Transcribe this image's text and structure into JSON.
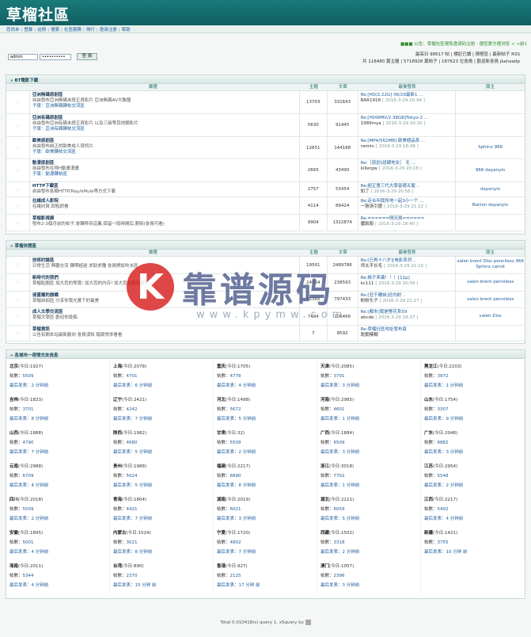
{
  "header": {
    "title": "草榴社區"
  },
  "nav": {
    "items": [
      "您尚未",
      "登錄",
      "註冊",
      "搜索",
      "社區服務",
      "排行",
      "邀请注册",
      "幫助"
    ]
  },
  "notice": "■■■ 公告：草榴社區現免邀请码注册 - 便您更方便浏览 < <前1",
  "stats": {
    "line1": "最高日 98617 帖 | 標記已讀 | 積極區 | 最新帖子 RSS",
    "line2": "共 118480 篇主題 | 5718928 篇帖子 | 187623 位會員 | 歡迎新會員 jkahaadp"
  },
  "login": {
    "user": "admin",
    "pass": "••••••••••",
    "submit": "登 錄"
  },
  "sections": {
    "bt": {
      "title": "» BT電影下載",
      "cols": [
        "論壇",
        "主題",
        "文章",
        "最後發表",
        "版主"
      ],
      "rows": [
        {
          "name": "亞洲無碼原創區",
          "desc": "自由發布亞洲無碼未經正資影片 亞洲無碼AV大聯盟",
          "sub": "子版：亞洲無碼轉帖交流區",
          "topics": "13703",
          "posts": "331643",
          "last": "Re:[HD/2.22G] 06/29最新1 ...",
          "by": "BAR1918",
          "date": "[ 2016-3-29 20:44 ]",
          "mod": ""
        },
        {
          "name": "亞洲有碼原創區",
          "desc": "自由發布亞洲有碼未經正資影片 以及三級等其他類影片",
          "sub": "子版：亞洲有碼轉帖交流區",
          "topics": "5630",
          "posts": "91445",
          "last": "Re:[HDWMV/2.38GB]Tokyo-2 ...",
          "by": "1989mya",
          "date": "[ 2016-3-29 20:20 ]",
          "mod": ""
        },
        {
          "name": "歐美原創區",
          "desc": "自由發布純正的歐美成人資訊片",
          "sub": "子版：歐美轉帖交流區",
          "topics": "12651",
          "posts": "144188",
          "last": "Re:[MP4/562MB] 歐美極品系 ...",
          "by": "nemin",
          "date": "[ 2016-3-29 18:48 ]",
          "mod": "Sphinx 966"
        },
        {
          "name": "動漫原創區",
          "desc": "自由發布在得H動畫漫畫",
          "sub": "子版：動漫轉帖區",
          "topics": "2665",
          "posts": "43490",
          "last": "Re:［原創]班肆地女］ 无 ...",
          "by": "killergw",
          "date": "[ 2016-3-29 20:18 ]",
          "mod": "966 dayanyin"
        },
        {
          "name": "HTTP下載區",
          "desc": "自由發布各類HTTP/Ray/eMule等方式下載",
          "sub": "",
          "topics": "2757",
          "posts": "53454",
          "last": "Re:超正童三代大學皆德五屋 ..",
          "by": "知了",
          "date": "[ 2016-3-29 20:56 ]",
          "mod": "dayanyin"
        },
        {
          "name": "在綫成人影院",
          "desc": "在綫欣賞,即點即看",
          "sub": "",
          "topics": "4114",
          "posts": "89424",
          "last": "Re:走合叫我所地一起3小一个 ...",
          "by": "一張清引證",
          "date": "[ 2016-3-29 21:22 ]",
          "mod": "Barton dayanyin"
        },
        {
          "name": "草榴影視庫",
          "desc": "發布2-3個月前的帖子,會轉移到這裏,保留一段時間后,刪除(會員可看)",
          "sub": "",
          "topics": "9904",
          "posts": "1322874",
          "last": "Re:======剛天兩======",
          "by": "魔凱殺",
          "date": "[ 2016-3-29 18:40 ]",
          "mod": ""
        }
      ]
    },
    "talk": {
      "title": "» 草榴休閒區",
      "cols": [
        "論壇",
        "主題",
        "文章",
        "最後發表",
        "版主"
      ],
      "rows": [
        {
          "name": "技術討論區",
          "desc": "日常生活 興趣交流 轉帶超過 求助求種 會員閑談吹水區",
          "sub": "",
          "topics": "19561",
          "posts": "2489786",
          "last": "Re:[已再十八岁][电影系列 ..",
          "by": "师太不长毛",
          "date": "[ 2016-3-29 21:10 ]",
          "mod": "valen brent Diss penniless 966 Sphinx carrot"
        },
        {
          "name": "新時代的我們",
          "desc": "草榴貼圖區 加大您的零寬! 加大您的内存! 加大您的腦容量!",
          "sub": "",
          "topics": "24564",
          "posts": "238593",
          "last": "Re:姊子来袭！！！[11p]",
          "by": "kc111",
          "date": "[ 2016-3-29 20:39 ]",
          "mod": "valen brent penniless"
        },
        {
          "name": "達蓋爾的旗幟",
          "desc": "草榴自拍區 分享你我光覺下的最美",
          "sub": "",
          "topics": "15365",
          "posts": "797433",
          "last": "Re:[狂干嫩妹]还内射 ..",
          "by": "粉粉头子",
          "date": "[ 2016-3-29 21:27 ]",
          "mod": "valen brent penniless"
        },
        {
          "name": "成人文學交流區",
          "desc": "草榴文學區 歡迎你投稿",
          "sub": "",
          "topics": "7494",
          "posts": "106466",
          "last": "Re:[都市]我是警花系59",
          "by": "abcde",
          "date": "[ 2016-3-29 19:37 ]",
          "mod": "valen Diss"
        },
        {
          "name": "草榴資訊",
          "desc": "公告有關本站最新動向 會員須知 錯誤常求看看",
          "sub": "",
          "topics": "7",
          "posts": "8592",
          "last": "Re:草榴社區地址發布頁",
          "by": "乾脆模糊",
          "date": "",
          "mod": ""
        }
      ]
    },
    "cities": {
      "title": "» 各城市一夜情交友信息",
      "labels": {
        "topics": "帖數：",
        "last": "最后发表："
      },
      "items": [
        {
          "name": "北京",
          "today": "(今日:1927)",
          "topics": "5509",
          "last": "2 分钟前"
        },
        {
          "name": "上海",
          "today": "(今日:2078)",
          "topics": "4701",
          "last": "6 分钟前"
        },
        {
          "name": "重庆",
          "today": "(今日:1705)",
          "topics": "4778",
          "last": "4 分钟前"
        },
        {
          "name": "天津",
          "today": "(今日:2085)",
          "topics": "3791",
          "last": "3 分钟前"
        },
        {
          "name": "黑龙江",
          "today": "(今日:2203)",
          "topics": "3972",
          "last": "1 分钟前"
        },
        {
          "name": "吉林",
          "today": "(今日:1823)",
          "topics": "3701",
          "last": "8 分钟前"
        },
        {
          "name": "辽宁",
          "today": "(今日:2421)",
          "topics": "4242",
          "last": "7 分钟前"
        },
        {
          "name": "河北",
          "today": "(今日:1498)",
          "topics": "5672",
          "last": "5 分钟前"
        },
        {
          "name": "河南",
          "today": "(今日:2985)",
          "topics": "4601",
          "last": "1 分钟前"
        },
        {
          "name": "山东",
          "today": "(今日:1754)",
          "topics": "3307",
          "last": "9 分钟前"
        },
        {
          "name": "山西",
          "today": "(今日:1888)",
          "topics": "4790",
          "last": "7 分钟前"
        },
        {
          "name": "陕西",
          "today": "(今日:1982)",
          "topics": "4680",
          "last": "5 分钟前"
        },
        {
          "name": "甘肃",
          "today": "(今日:32)",
          "topics": "5509",
          "last": "2 分钟前"
        },
        {
          "name": "广西",
          "today": "(今日:1884)",
          "topics": "6509",
          "last": "3 分钟前"
        },
        {
          "name": "广东",
          "today": "(今日:2048)",
          "topics": "6882",
          "last": "3 分钟前"
        },
        {
          "name": "云南",
          "today": "(今日:2988)",
          "topics": "6709",
          "last": "4 分钟前"
        },
        {
          "name": "贵州",
          "today": "(今日:1988)",
          "topics": "5024",
          "last": "5 分钟前"
        },
        {
          "name": "福建",
          "today": "(今日:2217)",
          "topics": "6890",
          "last": "8 分钟前"
        },
        {
          "name": "浙江",
          "today": "(今日:3018)",
          "topics": "7702",
          "last": "1 分钟前"
        },
        {
          "name": "江苏",
          "today": "(今日:2954)",
          "topics": "5548",
          "last": "2 分钟前"
        },
        {
          "name": "四川",
          "today": "(今日:2018)",
          "topics": "5509",
          "last": "2 分钟前"
        },
        {
          "name": "青海",
          "today": "(今日:1804)",
          "topics": "4421",
          "last": "7 分钟前"
        },
        {
          "name": "湖南",
          "today": "(今日:2019)",
          "topics": "6021",
          "last": "3 分钟前"
        },
        {
          "name": "湖北",
          "today": "(今日:2221)",
          "topics": "6059",
          "last": "5 分钟前"
        },
        {
          "name": "江西",
          "today": "(今日:2217)",
          "topics": "5402",
          "last": "4 分钟前"
        },
        {
          "name": "安徽",
          "today": "(今日:1895)",
          "topics": "5001",
          "last": "4 分钟前"
        },
        {
          "name": "内蒙古",
          "today": "(今日:1524)",
          "topics": "3021",
          "last": "8 分钟前"
        },
        {
          "name": "宁夏",
          "today": "(今日:1720)",
          "topics": "4802",
          "last": "7 分钟前"
        },
        {
          "name": "西藏",
          "today": "(今日:1502)",
          "topics": "3318",
          "last": "2 分钟前"
        },
        {
          "name": "新疆",
          "today": "(今日:1421)",
          "topics": "3755",
          "last": "10 分钟 前"
        },
        {
          "name": "海南",
          "today": "(今日:2011)",
          "topics": "5344",
          "last": "4 分钟前"
        },
        {
          "name": "台湾",
          "today": "(今日:890)",
          "topics": "2370",
          "last": "15 分钟 前"
        },
        {
          "name": "香港",
          "today": "(今日:927)",
          "topics": "2125",
          "last": "17 分钟 前"
        },
        {
          "name": "澳门",
          "today": "(今日:1057)",
          "topics": "2396",
          "last": "3 分钟前"
        }
      ]
    }
  },
  "footer": "Total 0.010418(s) query 1, xSquery by",
  "watermark": {
    "letter": "K",
    "text": "靠谱源码",
    "url": "www.kpymw.com"
  }
}
